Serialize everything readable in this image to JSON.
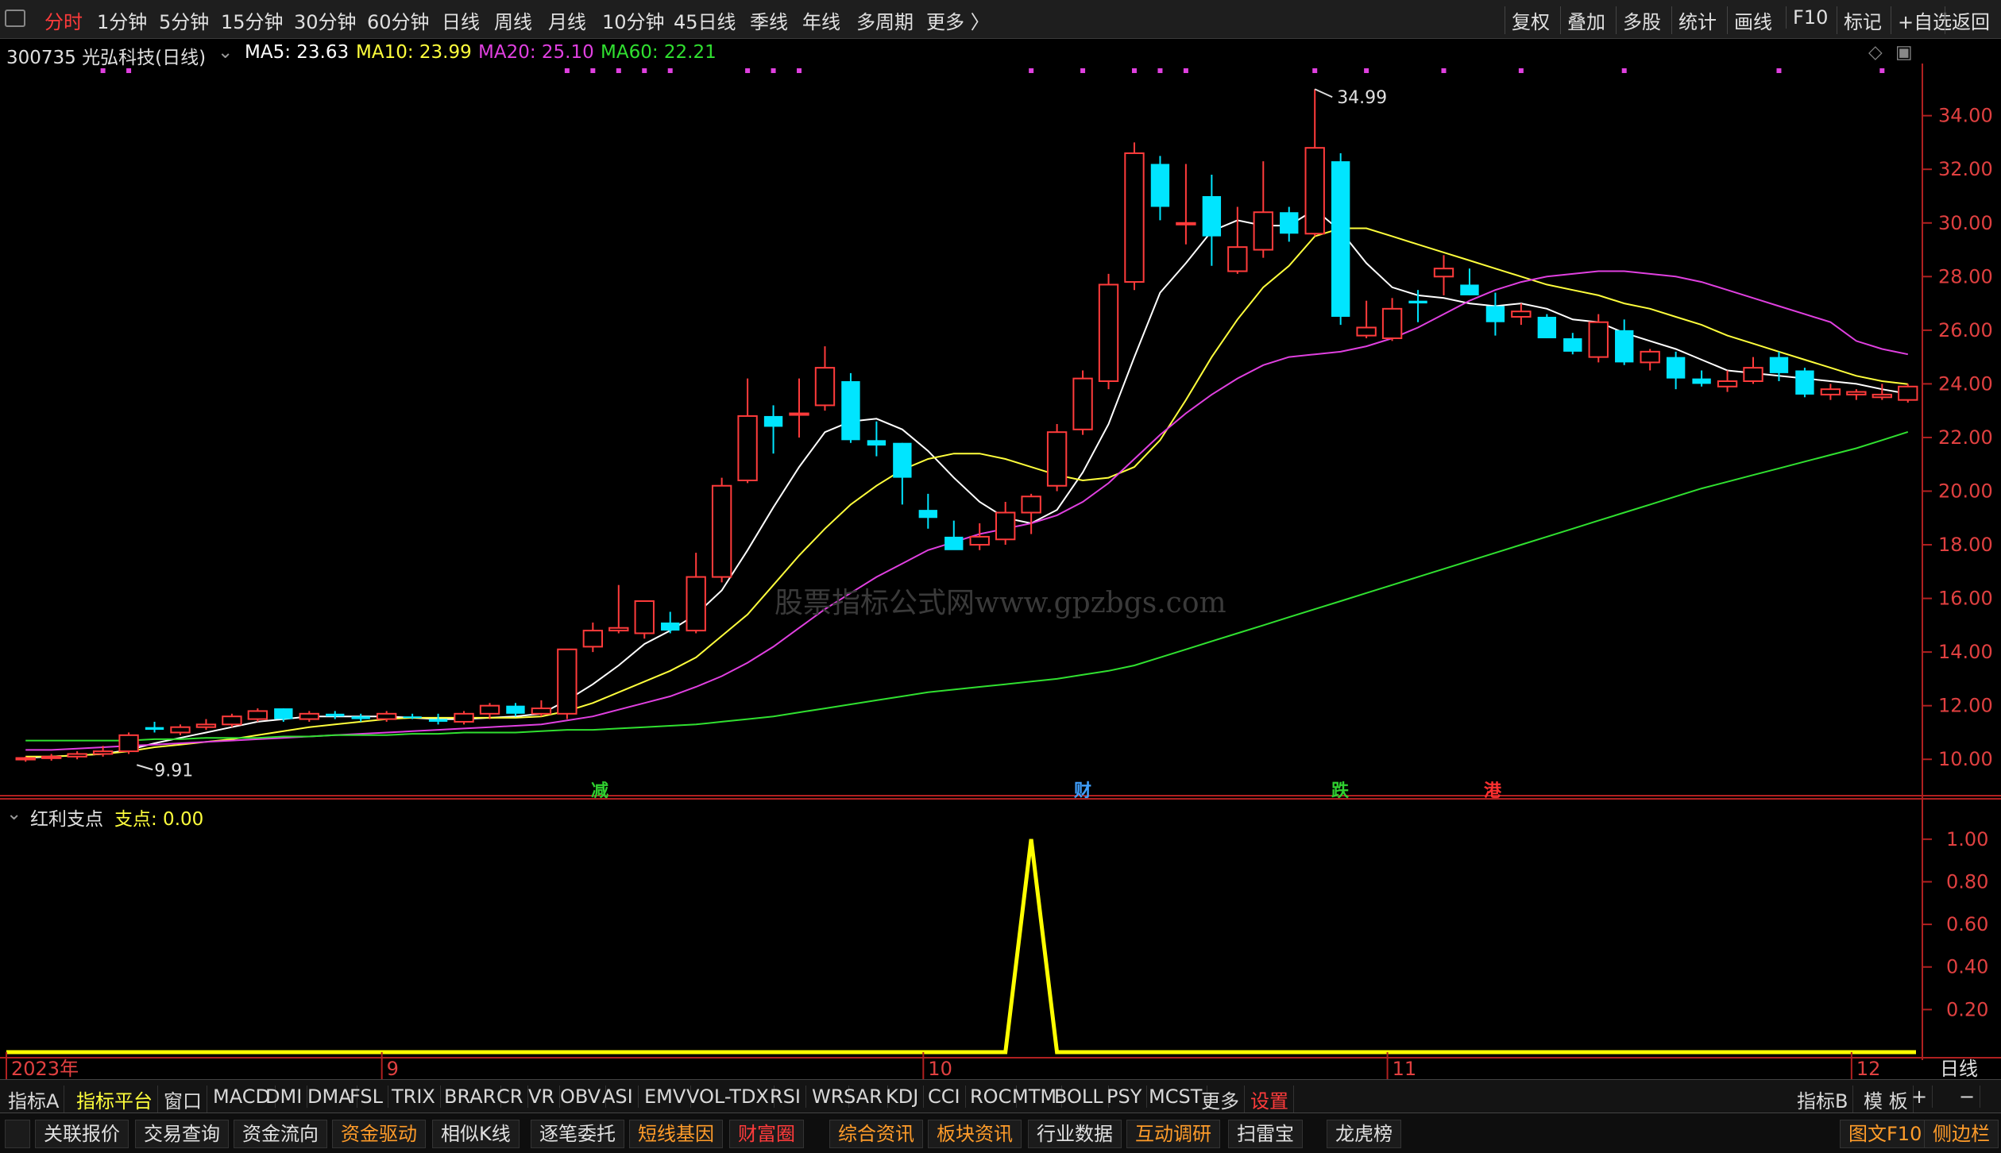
{
  "topbar": {
    "periods": [
      "分时",
      "1分钟",
      "5分钟",
      "15分钟",
      "30分钟",
      "60分钟",
      "日线",
      "周线",
      "月线",
      "10分钟",
      "45日线",
      "季线",
      "年线",
      "多周期",
      "更多 〉"
    ],
    "active_period": "分时",
    "tools": [
      "复权",
      "叠加",
      "多股",
      "统计",
      "画线",
      "F10",
      "标记",
      "+自选",
      "返回"
    ]
  },
  "header": {
    "stock": "300735 光弘科技(日线)",
    "ma5": "MA5: 23.63",
    "ma10": "MA10: 23.99",
    "ma20": "MA20: 25.10",
    "ma60": "MA60: 22.21",
    "colors": {
      "ma5": "#ffffff",
      "ma10": "#ffff3c",
      "ma20": "#e040e0",
      "ma60": "#30e030"
    }
  },
  "annotations": {
    "high_label": "34.99",
    "low_label": "9.91"
  },
  "signals": [
    {
      "text": "减",
      "color": "#30d030"
    },
    {
      "text": "财",
      "color": "#40a0ff"
    },
    {
      "text": "跌",
      "color": "#30d030"
    },
    {
      "text": "港",
      "color": "#ff3030"
    }
  ],
  "watermark": "股票指标公式网www.gpzbgs.com",
  "subchart": {
    "name": "红利支点",
    "value_label": "支点: 0.00"
  },
  "x_axis_labels": [
    "2023年",
    "9",
    "10",
    "11",
    "12"
  ],
  "axis_unit_label": "日线",
  "chart_data": [
    {
      "type": "candlestick",
      "title": "300735 光弘科技(日线)",
      "ylim": [
        9,
        35.5
      ],
      "y_ticks": [
        10,
        12,
        14,
        16,
        18,
        20,
        22,
        24,
        26,
        28,
        30,
        32,
        34
      ],
      "y_tick_labels": [
        "10.00",
        "12.00",
        "14.00",
        "16.00",
        "18.00",
        "20.00",
        "22.00",
        "24.00",
        "26.00",
        "28.00",
        "30.00",
        "32.00",
        "34.00"
      ],
      "ohlc": [
        [
          10.0,
          10.1,
          9.91,
          10.05
        ],
        [
          10.05,
          10.2,
          9.95,
          10.1
        ],
        [
          10.1,
          10.3,
          10.0,
          10.2
        ],
        [
          10.2,
          10.5,
          10.1,
          10.3
        ],
        [
          10.3,
          11.0,
          10.2,
          10.9
        ],
        [
          11.2,
          11.4,
          11.0,
          11.1
        ],
        [
          11.0,
          11.3,
          10.9,
          11.2
        ],
        [
          11.2,
          11.5,
          11.1,
          11.3
        ],
        [
          11.3,
          11.7,
          11.2,
          11.6
        ],
        [
          11.5,
          11.9,
          11.4,
          11.8
        ],
        [
          11.9,
          11.9,
          11.4,
          11.5
        ],
        [
          11.5,
          11.8,
          11.4,
          11.7
        ],
        [
          11.7,
          11.8,
          11.5,
          11.6
        ],
        [
          11.6,
          11.7,
          11.4,
          11.5
        ],
        [
          11.5,
          11.8,
          11.4,
          11.7
        ],
        [
          11.6,
          11.7,
          11.5,
          11.55
        ],
        [
          11.5,
          11.7,
          11.3,
          11.4
        ],
        [
          11.4,
          11.8,
          11.3,
          11.7
        ],
        [
          11.7,
          12.1,
          11.5,
          12.0
        ],
        [
          12.0,
          12.1,
          11.6,
          11.7
        ],
        [
          11.7,
          12.2,
          11.6,
          11.9
        ],
        [
          11.7,
          12.4,
          11.5,
          14.1
        ],
        [
          14.2,
          15.1,
          14.0,
          14.8
        ],
        [
          14.8,
          16.5,
          14.7,
          14.9
        ],
        [
          14.7,
          15.9,
          14.5,
          15.9
        ],
        [
          15.1,
          15.5,
          14.7,
          14.8
        ],
        [
          14.8,
          17.7,
          14.7,
          16.8
        ],
        [
          16.8,
          20.5,
          16.6,
          20.2
        ],
        [
          20.4,
          24.2,
          20.3,
          22.8
        ],
        [
          22.8,
          23.2,
          21.4,
          22.4
        ],
        [
          22.9,
          24.2,
          22.0,
          22.9
        ],
        [
          23.2,
          25.4,
          23.0,
          24.6
        ],
        [
          24.1,
          24.4,
          21.8,
          21.9
        ],
        [
          21.9,
          22.6,
          21.3,
          21.7
        ],
        [
          21.8,
          21.8,
          19.5,
          20.5
        ],
        [
          19.3,
          19.9,
          18.6,
          19.0
        ],
        [
          18.3,
          18.9,
          17.9,
          17.8
        ],
        [
          18.0,
          18.8,
          17.8,
          18.3
        ],
        [
          18.2,
          19.6,
          18.0,
          19.2
        ],
        [
          19.2,
          19.9,
          18.4,
          19.8
        ],
        [
          20.2,
          22.5,
          20.0,
          22.2
        ],
        [
          22.3,
          24.5,
          22.1,
          24.2
        ],
        [
          24.1,
          28.1,
          23.8,
          27.7
        ],
        [
          27.8,
          33.0,
          27.5,
          32.6
        ],
        [
          32.2,
          32.5,
          30.1,
          30.6
        ],
        [
          30.0,
          32.2,
          29.2,
          30.0
        ],
        [
          31.0,
          31.8,
          28.4,
          29.5
        ],
        [
          28.2,
          30.6,
          28.1,
          29.1
        ],
        [
          29.0,
          32.3,
          28.7,
          30.4
        ],
        [
          30.4,
          30.6,
          29.3,
          29.6
        ],
        [
          29.6,
          34.99,
          29.5,
          32.8
        ],
        [
          32.3,
          32.6,
          26.2,
          26.5
        ],
        [
          25.8,
          27.1,
          25.7,
          26.1
        ],
        [
          25.7,
          27.2,
          25.6,
          26.8
        ],
        [
          27.1,
          27.5,
          26.3,
          27.0
        ],
        [
          28.0,
          28.8,
          27.3,
          28.3
        ],
        [
          27.7,
          28.3,
          27.3,
          27.3
        ],
        [
          26.9,
          27.4,
          25.8,
          26.3
        ],
        [
          26.5,
          27.0,
          26.2,
          26.7
        ],
        [
          26.5,
          26.6,
          25.7,
          25.7
        ],
        [
          25.7,
          25.9,
          25.1,
          25.2
        ],
        [
          25.0,
          26.6,
          24.8,
          26.3
        ],
        [
          26.0,
          26.4,
          24.7,
          24.8
        ],
        [
          24.8,
          25.3,
          24.5,
          25.2
        ],
        [
          25.0,
          25.2,
          23.8,
          24.2
        ],
        [
          24.2,
          24.5,
          23.9,
          24.0
        ],
        [
          23.9,
          24.5,
          23.7,
          24.1
        ],
        [
          24.1,
          25.0,
          24.0,
          24.6
        ],
        [
          25.0,
          25.2,
          24.1,
          24.4
        ],
        [
          24.5,
          24.6,
          23.5,
          23.6
        ],
        [
          23.6,
          24.0,
          23.4,
          23.8
        ],
        [
          23.6,
          23.8,
          23.4,
          23.7
        ],
        [
          23.5,
          24.0,
          23.4,
          23.6
        ],
        [
          23.4,
          24.0,
          23.3,
          23.9
        ]
      ],
      "series": [
        {
          "name": "MA5",
          "values": [
            10.05,
            10.1,
            10.15,
            10.2,
            10.35,
            10.6,
            10.8,
            11.0,
            11.2,
            11.4,
            11.5,
            11.6,
            11.6,
            11.6,
            11.6,
            11.55,
            11.5,
            11.5,
            11.55,
            11.6,
            11.7,
            12.2,
            12.8,
            13.5,
            14.3,
            14.8,
            15.4,
            16.3,
            17.8,
            19.4,
            20.9,
            22.2,
            22.6,
            22.7,
            22.3,
            21.5,
            20.5,
            19.6,
            19.0,
            18.8,
            19.3,
            20.7,
            22.5,
            25.0,
            27.4,
            28.5,
            29.7,
            30.1,
            29.9,
            29.9,
            30.5,
            29.7,
            28.5,
            27.6,
            27.3,
            27.2,
            27.0,
            26.9,
            27.0,
            26.8,
            26.4,
            26.3,
            25.9,
            25.6,
            25.3,
            24.9,
            24.5,
            24.4,
            24.3,
            24.2,
            24.1,
            24.0,
            23.8,
            23.63
          ]
        },
        {
          "name": "MA10",
          "values": [
            10.1,
            10.1,
            10.15,
            10.2,
            10.3,
            10.45,
            10.55,
            10.65,
            10.75,
            10.9,
            11.05,
            11.2,
            11.3,
            11.4,
            11.5,
            11.55,
            11.55,
            11.55,
            11.55,
            11.55,
            11.6,
            11.8,
            12.1,
            12.5,
            12.9,
            13.3,
            13.8,
            14.6,
            15.4,
            16.5,
            17.6,
            18.6,
            19.5,
            20.2,
            20.8,
            21.2,
            21.4,
            21.4,
            21.2,
            20.9,
            20.6,
            20.4,
            20.5,
            20.9,
            21.9,
            23.4,
            25.0,
            26.4,
            27.6,
            28.4,
            29.5,
            29.8,
            29.8,
            29.5,
            29.2,
            28.9,
            28.6,
            28.3,
            28.0,
            27.7,
            27.5,
            27.3,
            27.0,
            26.8,
            26.5,
            26.2,
            25.8,
            25.5,
            25.2,
            24.9,
            24.6,
            24.3,
            24.1,
            23.99
          ]
        },
        {
          "name": "MA20",
          "values": [
            10.35,
            10.35,
            10.4,
            10.45,
            10.5,
            10.55,
            10.6,
            10.65,
            10.7,
            10.75,
            10.8,
            10.85,
            10.9,
            10.95,
            11.0,
            11.05,
            11.1,
            11.15,
            11.2,
            11.25,
            11.3,
            11.45,
            11.6,
            11.85,
            12.1,
            12.35,
            12.7,
            13.1,
            13.6,
            14.2,
            14.9,
            15.6,
            16.2,
            16.8,
            17.3,
            17.8,
            18.1,
            18.4,
            18.6,
            18.8,
            19.1,
            19.6,
            20.3,
            21.2,
            22.1,
            22.9,
            23.6,
            24.2,
            24.7,
            25.0,
            25.1,
            25.2,
            25.4,
            25.7,
            26.1,
            26.6,
            27.1,
            27.5,
            27.8,
            28.0,
            28.1,
            28.2,
            28.2,
            28.1,
            28.0,
            27.8,
            27.5,
            27.2,
            26.9,
            26.6,
            26.3,
            25.6,
            25.3,
            25.1
          ]
        },
        {
          "name": "MA60",
          "values": [
            10.7,
            10.7,
            10.7,
            10.7,
            10.7,
            10.75,
            10.75,
            10.8,
            10.8,
            10.8,
            10.85,
            10.85,
            10.9,
            10.9,
            10.9,
            10.95,
            10.95,
            11.0,
            11.0,
            11.0,
            11.05,
            11.1,
            11.1,
            11.15,
            11.2,
            11.25,
            11.3,
            11.4,
            11.5,
            11.6,
            11.75,
            11.9,
            12.05,
            12.2,
            12.35,
            12.5,
            12.6,
            12.7,
            12.8,
            12.9,
            13.0,
            13.15,
            13.3,
            13.5,
            13.8,
            14.1,
            14.4,
            14.7,
            15.0,
            15.3,
            15.6,
            15.9,
            16.2,
            16.5,
            16.8,
            17.1,
            17.4,
            17.7,
            18.0,
            18.3,
            18.6,
            18.9,
            19.2,
            19.5,
            19.8,
            20.1,
            20.35,
            20.6,
            20.85,
            21.1,
            21.35,
            21.6,
            21.9,
            22.21
          ]
        }
      ]
    },
    {
      "type": "line",
      "title": "红利支点",
      "ylim": [
        0,
        1.1
      ],
      "y_ticks": [
        0.2,
        0.4,
        0.6,
        0.8,
        1.0
      ],
      "y_tick_labels": [
        "0.20",
        "0.40",
        "0.60",
        "0.80",
        "1.00"
      ],
      "series": [
        {
          "name": "支点",
          "values": [
            0,
            0,
            0,
            0,
            0,
            0,
            0,
            0,
            0,
            0,
            0,
            0,
            0,
            0,
            0,
            0,
            0,
            0,
            0,
            0,
            0,
            0,
            0,
            0,
            0,
            0,
            0,
            0,
            0,
            0,
            0,
            0,
            0,
            0,
            0,
            0,
            0,
            0,
            0,
            1,
            0,
            0,
            0,
            0,
            0,
            0,
            0,
            0,
            0,
            0,
            0,
            0,
            0,
            0,
            0,
            0,
            0,
            0,
            0,
            0,
            0,
            0,
            0,
            0,
            0,
            0,
            0,
            0,
            0,
            0,
            0,
            0,
            0,
            0
          ]
        }
      ]
    }
  ],
  "tabs_row1": [
    "指标A",
    "指标平台",
    "窗口",
    "MACD",
    "DMI",
    "DMA",
    "FSL",
    "TRIX",
    "BRAR",
    "CR",
    "VR",
    "OBV",
    "ASI",
    "EMV",
    "VOL-TDX",
    "RSI",
    "WR",
    "SAR",
    "KDJ",
    "CCI",
    "ROC",
    "MTM",
    "BOLL",
    "PSY",
    "MCST",
    "更多",
    "设置"
  ],
  "tabs_row1_right": [
    "指标B",
    "模 板",
    "+",
    "−"
  ],
  "tabs_row2": [
    "关联报价",
    "交易查询",
    "资金流向",
    "资金驱动",
    "相似K线",
    "逐笔委托",
    "短线基因",
    "财富圈",
    "综合资讯",
    "板块资讯",
    "行业数据",
    "互动调研",
    "扫雷宝",
    "龙虎榜"
  ],
  "tabs_row2_right": [
    "图文F10",
    "侧边栏"
  ]
}
